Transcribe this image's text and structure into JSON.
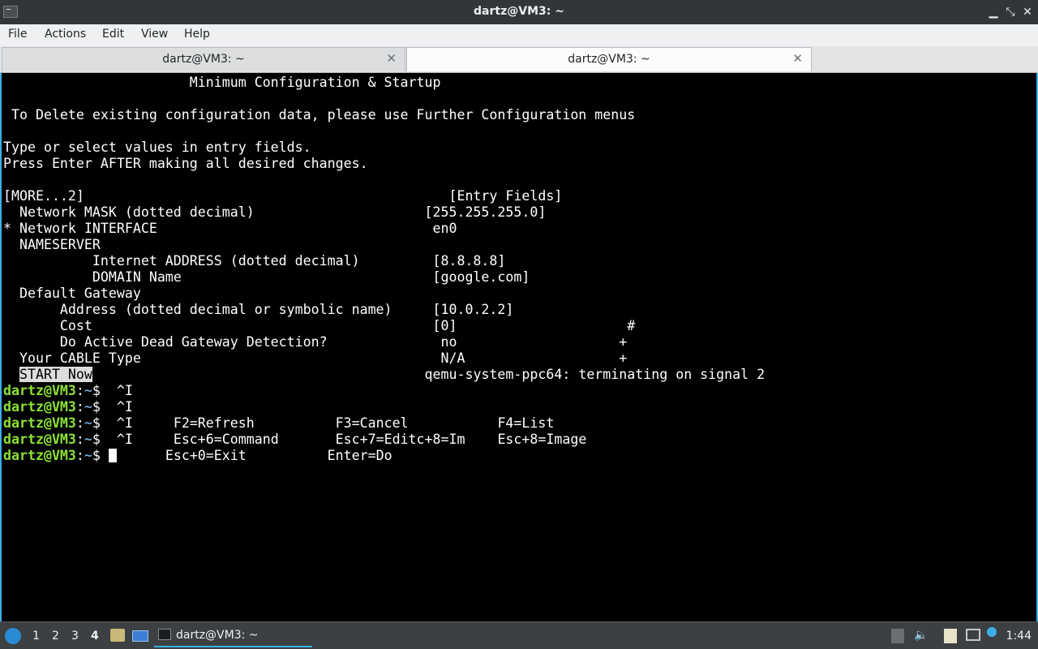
{
  "window": {
    "title": "dartz@VM3: ~",
    "minimize_glyph": "▁",
    "maximize_glyph": "⤡",
    "close_glyph": "✕"
  },
  "menu": [
    "File",
    "Actions",
    "Edit",
    "View",
    "Help"
  ],
  "tabs": [
    {
      "label": "dartz@VM3: ~",
      "active": false
    },
    {
      "label": "dartz@VM3: ~",
      "active": true
    }
  ],
  "tab_close_glyph": "✕",
  "terminal": {
    "lines": [
      "                       Minimum Configuration & Startup",
      "",
      " To Delete existing configuration data, please use Further Configuration menus",
      "",
      "Type or select values in entry fields.",
      "Press Enter AFTER making all desired changes.",
      "",
      "[MORE...2]                                             [Entry Fields]",
      "  Network MASK (dotted decimal)                     [255.255.255.0]",
      "* Network INTERFACE                                  en0",
      "  NAMESERVER",
      "           Internet ADDRESS (dotted decimal)         [8.8.8.8]",
      "           DOMAIN Name                               [google.com]",
      "  Default Gateway",
      "       Address (dotted decimal or symbolic name)     [10.0.2.2]",
      "       Cost                                          [0]                     #",
      "       Do Active Dead Gateway Detection?              no                    +",
      "  Your CABLE Type                                     N/A                   +"
    ],
    "start_now": {
      "indent": "  ",
      "highlight": "START Now",
      "rest": "                                         qemu-system-ppc64: terminating on signal 2"
    },
    "prompt": {
      "user": "dartz@VM3",
      "sep": ":",
      "path": "~",
      "sym": "$ "
    },
    "prompt_lines": [
      " ^I",
      " ^I",
      " ^I     F2=Refresh          F3=Cancel           F4=List",
      " ^I     Esc+6=Command       Esc+7=Editc+8=Im    Esc+8=Image"
    ],
    "last_line_after_cursor": "      Esc+0=Exit          Enter=Do"
  },
  "taskbar": {
    "desktops": [
      "1",
      "2",
      "3",
      "4"
    ],
    "current_desktop": "4",
    "task_label": "dartz@VM3: ~",
    "clock": "1:44",
    "tray_icons": [
      "usb-icon",
      "volume-icon",
      "clipboard-icon",
      "monitor-icon",
      "update-notifier-icon"
    ]
  }
}
